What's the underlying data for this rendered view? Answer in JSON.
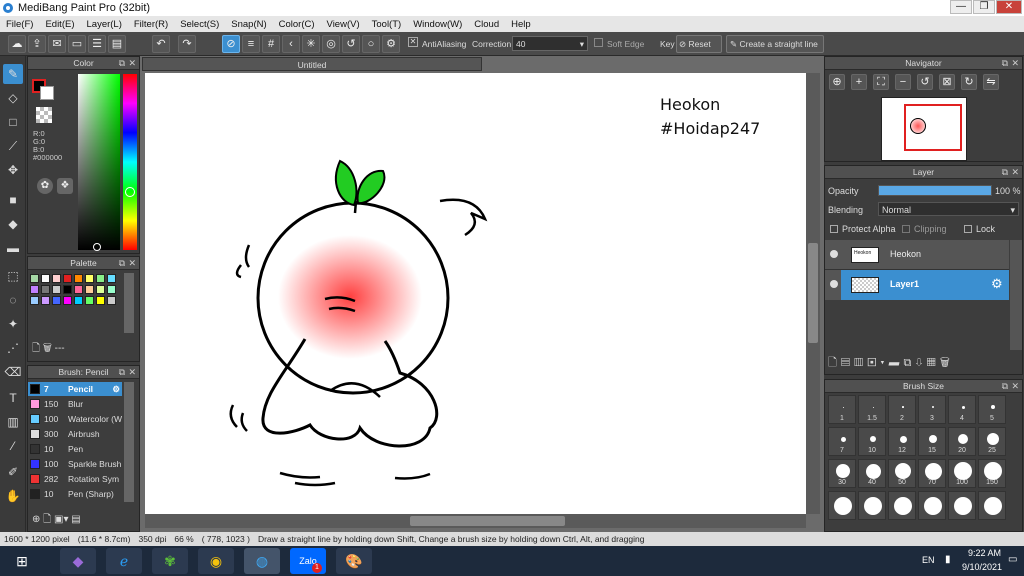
{
  "app": {
    "title": "MediBang Paint Pro (32bit)",
    "win_min": "—",
    "win_max": "❐",
    "win_close": "✕"
  },
  "menu": [
    "File(F)",
    "Edit(E)",
    "Layer(L)",
    "Filter(R)",
    "Select(S)",
    "Snap(N)",
    "Color(C)",
    "View(V)",
    "Tool(T)",
    "Window(W)",
    "Cloud",
    "Help"
  ],
  "toolbar": {
    "antialias": "AntiAliasing",
    "correction_label": "Correction",
    "correction_value": "40",
    "soft_edge": "Soft Edge",
    "key": "Key",
    "reset": "Reset",
    "straight_line": "Create a straight line"
  },
  "color_panel": {
    "title": "Color",
    "r": "R:0",
    "g": "G:0",
    "b": "B:0",
    "hex": "#000000"
  },
  "palette_panel": {
    "title": "Palette",
    "footer": "---"
  },
  "brush_panel": {
    "title": "Brush: Pencil",
    "items": [
      {
        "size": "7",
        "name": "Pencil",
        "color": "#000000"
      },
      {
        "size": "150",
        "name": "Blur",
        "color": "#ff99dd"
      },
      {
        "size": "100",
        "name": "Watercolor (W",
        "color": "#66ccff"
      },
      {
        "size": "300",
        "name": "Airbrush",
        "color": "#dddddd"
      },
      {
        "size": "10",
        "name": "Pen",
        "color": "#333333"
      },
      {
        "size": "100",
        "name": "Sparkle Brush",
        "color": "#3333ff"
      },
      {
        "size": "282",
        "name": "Rotation Sym",
        "color": "#ee3333"
      },
      {
        "size": "10",
        "name": "Pen (Sharp)",
        "color": "#222222"
      }
    ]
  },
  "canvas": {
    "tab": "Untitled",
    "text1": "Heokon",
    "text2": "#Hoidap247"
  },
  "navigator": {
    "title": "Navigator"
  },
  "layer_panel": {
    "title": "Layer",
    "opacity_label": "Opacity",
    "opacity_value": "100 %",
    "opacity_level": 1.0,
    "blending_label": "Blending",
    "blending_value": "Normal",
    "protect_alpha": "Protect Alpha",
    "clipping": "Clipping",
    "lock": "Lock",
    "layers": [
      {
        "name": "Heokon"
      },
      {
        "name": "Layer1"
      }
    ]
  },
  "brush_size_panel": {
    "title": "Brush Size",
    "sizes": [
      "1",
      "1.5",
      "2",
      "3",
      "4",
      "5",
      "7",
      "10",
      "12",
      "15",
      "20",
      "25",
      "30",
      "40",
      "50",
      "70",
      "100",
      "150",
      "",
      "",
      "",
      "",
      "",
      ""
    ]
  },
  "status": {
    "dimensions": "1600 * 1200 pixel",
    "physical": "(11.6 * 8.7cm)",
    "dpi": "350 dpi",
    "zoom": "66 %",
    "coords": "( 778, 1023 )",
    "hint": "Draw a straight line by holding down Shift, Change a brush size by holding down Ctrl, Alt, and dragging"
  },
  "taskbar": {
    "lang": "EN",
    "time": "9:22 AM",
    "date": "9/10/2021",
    "zalo_badge": "1"
  },
  "colors": {
    "accent": "#3b8fd0",
    "panel": "#3d3d3d"
  }
}
